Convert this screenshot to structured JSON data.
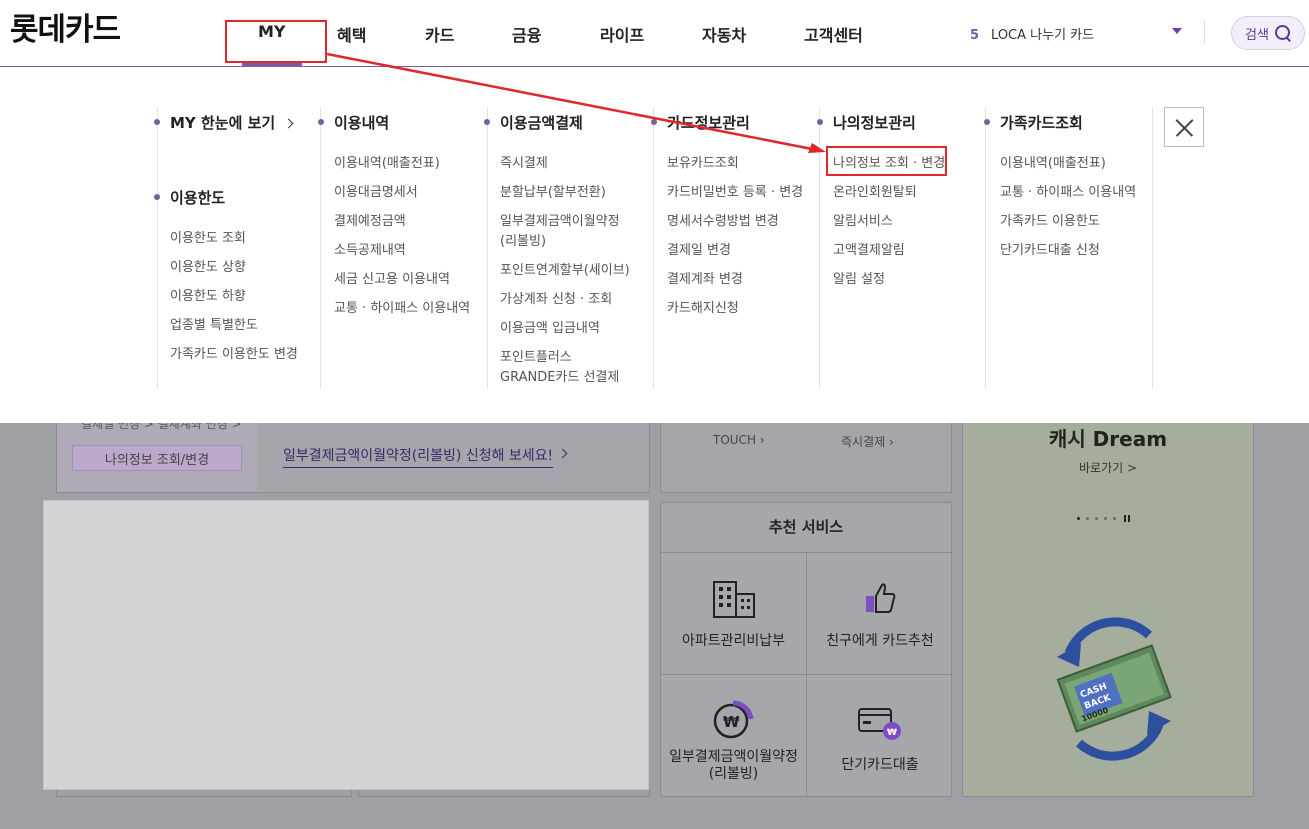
{
  "header": {
    "logo": "롯데카드",
    "gnb": [
      "MY",
      "혜택",
      "카드",
      "금융",
      "라이프",
      "자동차",
      "고객센터"
    ],
    "promo_num": "5",
    "promo_text": "LOCA 나누기 카드",
    "search_label": "검색"
  },
  "mega": {
    "col1": {
      "cat1": "MY 한눈에 보기",
      "cat2": "이용한도",
      "items": [
        "이용한도 조회",
        "이용한도 상향",
        "이용한도 하향",
        "업종별 특별한도",
        "가족카드 이용한도 변경"
      ]
    },
    "col2": {
      "cat": "이용내역",
      "items": [
        "이용내역(매출전표)",
        "이용대금명세서",
        "결제예정금액",
        "소득공제내역",
        "세금 신고용 이용내역",
        "교통 · 하이패스 이용내역"
      ]
    },
    "col3": {
      "cat": "이용금액결제",
      "items": [
        "즉시결제",
        "분할납부(할부전환)",
        "일부결제금액이월약정",
        "(리볼빙)",
        "포인트연계할부(세이브)",
        "가상계좌 신청 · 조회",
        "이용금액 입금내역",
        "포인트플러스",
        "GRANDE카드 선결제"
      ]
    },
    "col4": {
      "cat": "카드정보관리",
      "items": [
        "보유카드조회",
        "카드비밀번호 등록 · 변경",
        "명세서수령방법 변경",
        "결제일 변경",
        "결제계좌 변경",
        "카드해지신청"
      ]
    },
    "col5": {
      "cat": "나의정보관리",
      "items": [
        "나의정보 조회 · 변경",
        "온라인회원탈퇴",
        "알림서비스",
        "고액결제알림",
        "알림 설정"
      ]
    },
    "col6": {
      "cat": "가족카드조회",
      "items": [
        "이용내역(매출전표)",
        "교통 · 하이패스 이용내역",
        "가족카드 이용한도",
        "단기카드대출 신청"
      ]
    }
  },
  "background": {
    "hint": "결제일 변경 >   결제계좌 변경 >",
    "my_info_btn": "나의정보 조회/변경",
    "revolve_link": "일부결제금액이월약정(리볼빙) 신청해 보세요!",
    "touch": "TOUCH",
    "instant": "즉시결제",
    "cash_dream": "캐시 Dream",
    "goto": "바로가기 >",
    "rec_title": "추천 서비스",
    "rec_items": [
      "아파트관리비납부",
      "친구에게 카드추천",
      "일부결제금액이월약정",
      "(리볼빙)",
      "단기카드대출"
    ],
    "cash_back": "CASH BACK",
    "bill": "10000"
  },
  "colors": {
    "accent": "#7b5aa6",
    "annotation": "#e0282c"
  }
}
